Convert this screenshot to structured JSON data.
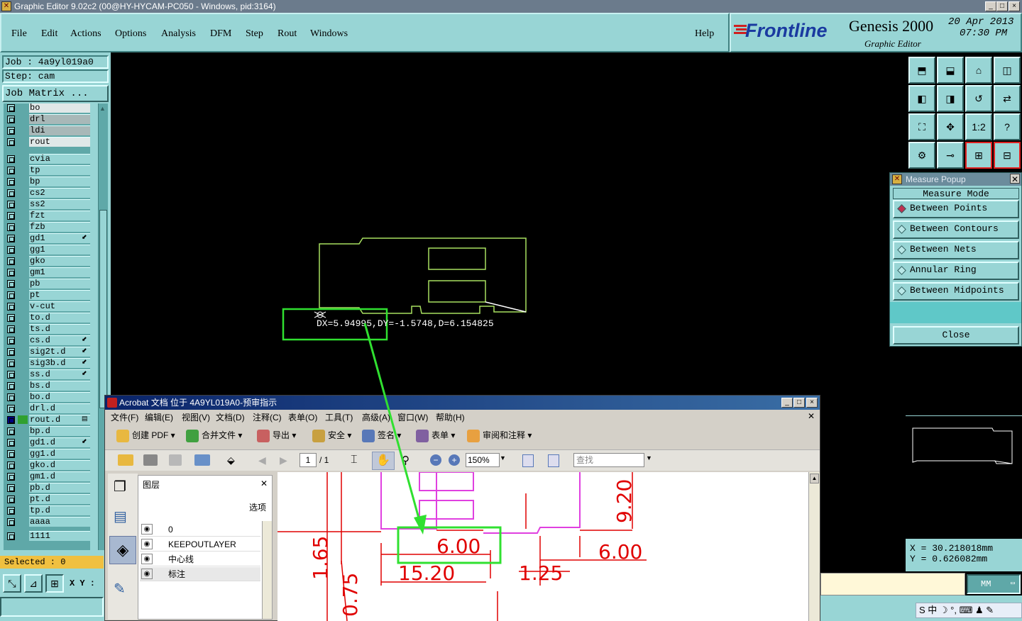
{
  "window": {
    "title": "Graphic Editor 9.02c2 (00@HY-HYCAM-PC050 - Windows, pid:3164)",
    "btn_min": "_",
    "btn_max": "□",
    "btn_close": "×"
  },
  "menus": [
    "File",
    "Edit",
    "Actions",
    "Options",
    "Analysis",
    "DFM",
    "Step",
    "Rout",
    "Windows"
  ],
  "help": "Help",
  "brand": {
    "logo": "Frontline",
    "product": "Genesis 2000",
    "sub": "Graphic Editor",
    "date": "20 Apr 2013",
    "time": "07:30 PM"
  },
  "job": {
    "job": "Job : 4a9yl019a0",
    "step": "Step: cam",
    "matrix": "Job Matrix ..."
  },
  "layers": [
    {
      "name": "bo",
      "style": "white"
    },
    {
      "name": "drl",
      "style": "grey"
    },
    {
      "name": "ldi",
      "style": "grey"
    },
    {
      "name": "rout",
      "style": "white"
    },
    {
      "name": "cvia"
    },
    {
      "name": "tp"
    },
    {
      "name": "bp"
    },
    {
      "name": "cs2"
    },
    {
      "name": "ss2"
    },
    {
      "name": "fzt"
    },
    {
      "name": "fzb"
    },
    {
      "name": "gd1",
      "mark": "⬋"
    },
    {
      "name": "gg1"
    },
    {
      "name": "gko"
    },
    {
      "name": "gm1"
    },
    {
      "name": "pb"
    },
    {
      "name": "pt"
    },
    {
      "name": "v-cut"
    },
    {
      "name": "to.d"
    },
    {
      "name": "ts.d"
    },
    {
      "name": "cs.d",
      "mark": "⬋"
    },
    {
      "name": "sig2t.d",
      "mark": "⬋"
    },
    {
      "name": "sig3b.d",
      "mark": "⬋"
    },
    {
      "name": "ss.d",
      "mark": "⬋"
    },
    {
      "name": "bs.d"
    },
    {
      "name": "bo.d"
    },
    {
      "name": "drl.d"
    },
    {
      "name": "rout.d",
      "mark": "▤",
      "active": true
    },
    {
      "name": "bp.d"
    },
    {
      "name": "gd1.d",
      "mark": "⬋"
    },
    {
      "name": "gg1.d"
    },
    {
      "name": "gko.d"
    },
    {
      "name": "gm1.d"
    },
    {
      "name": "pb.d"
    },
    {
      "name": "pt.d"
    },
    {
      "name": "tp.d"
    },
    {
      "name": "aaaa"
    },
    {
      "name": "1111"
    }
  ],
  "selected": "Selected : 0",
  "xy_label": "X Y :",
  "measure": {
    "title": "Measure Popup",
    "header": "Measure Mode",
    "options": [
      "Between Points",
      "Between Contours",
      "Between Nets",
      "Annular Ring",
      "Between Midpoints"
    ],
    "close": "Close"
  },
  "readout": "DX=5.94995,DY=-1.5748,D=6.154825",
  "coords": {
    "x": "X  = 30.218018mm",
    "y": "Y  = 0.626082mm"
  },
  "units": "MM",
  "toolbar_icons": [
    "top-view-icon",
    "bottom-view-icon",
    "home-icon",
    "panel-icon",
    "left-arrow-icon",
    "right-arrow-icon",
    "rotate-icon",
    "flip-icon",
    "fit-icon",
    "center-icon",
    "ratio-icon",
    "help-icon",
    "settings-icon",
    "key-icon",
    "net-icon",
    "drill-icon"
  ],
  "toolbar_glyphs": [
    "⬒",
    "⬓",
    "⌂",
    "◫",
    "◧",
    "◨",
    "↺",
    "⇄",
    "⛶",
    "✥",
    "1:2",
    "?",
    "⚙",
    "⊸",
    "⊞",
    "⊟"
  ],
  "acrobat": {
    "title": "Acrobat 文档 位于 4A9YL019A0-预审指示",
    "menus": [
      "文件(F)",
      "编辑(E)",
      "视图(V)",
      "文档(D)",
      "注释(C)",
      "表单(O)",
      "工具(T)",
      "高级(A)",
      "窗口(W)",
      "帮助(H)"
    ],
    "tools": [
      "创建 PDF",
      "合并文件",
      "导出",
      "安全",
      "签名",
      "表单",
      "审阅和注释"
    ],
    "page": "1",
    "pages": "/ 1",
    "zoom": "150%",
    "search": "查找",
    "layers_title": "图层",
    "options": "选项",
    "layer_names": [
      "0",
      "KEEPOUTLAYER",
      "中心线",
      "标注"
    ]
  },
  "dims": [
    "6.00",
    "15.20",
    "1.25",
    "6.00",
    "9.20",
    "1.65",
    "0.75"
  ],
  "ime": "S 中 ☽ °, ⌨ ♟ ✎"
}
